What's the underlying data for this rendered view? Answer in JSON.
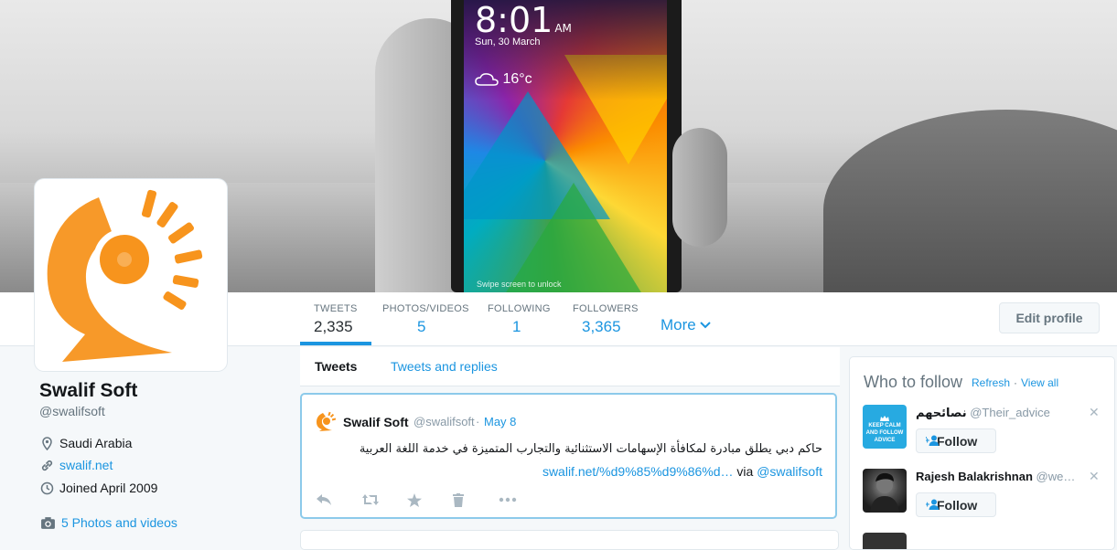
{
  "phone_screen": {
    "time": "8:01",
    "ampm": "AM",
    "date": "Sun, 30 March",
    "temperature": "16°c",
    "swipe_hint": "Swipe screen to unlock"
  },
  "profile": {
    "name": "Swalif Soft",
    "handle": "@swalifsoft",
    "location": "Saudi Arabia",
    "website": "swalif.net",
    "joined": "Joined April 2009",
    "photos_link": "5 Photos and videos"
  },
  "nav": {
    "stats": [
      {
        "label": "TWEETS",
        "value": "2,335"
      },
      {
        "label": "PHOTOS/VIDEOS",
        "value": "5"
      },
      {
        "label": "FOLLOWING",
        "value": "1"
      },
      {
        "label": "FOLLOWERS",
        "value": "3,365"
      }
    ],
    "more_label": "More",
    "edit_profile_label": "Edit profile"
  },
  "tabs": [
    {
      "label": "Tweets"
    },
    {
      "label": "Tweets and replies"
    }
  ],
  "tweet": {
    "author": "Swalif Soft",
    "handle": "@swalifsoft",
    "separator": "·",
    "date": "May 8",
    "text": "حاكم دبي يطلق مبادرة لمكافأة الإسهامات الاستثنائية والتجارب المتميزة في خدمة اللغة العربية",
    "link": "swalif.net/%d9%85%d9%86%d…",
    "via": "via",
    "mention": "@swalifsoft"
  },
  "who_to_follow": {
    "title": "Who to follow",
    "separator": "·",
    "refresh": "Refresh",
    "view_all": "View all",
    "suggestions": [
      {
        "name": "نصائحهم",
        "handle": "@Their_advice",
        "follow": "Follow",
        "avatar_text": "KEEP CALM AND FOLLOW ADVICE"
      },
      {
        "name": "Rajesh Balakrishnan",
        "handle": "@we…",
        "follow": "Follow"
      }
    ]
  },
  "colors": {
    "accent": "#1b95e0",
    "text": "#14171a",
    "muted": "#66757f",
    "logo_orange": "#f7941d"
  }
}
